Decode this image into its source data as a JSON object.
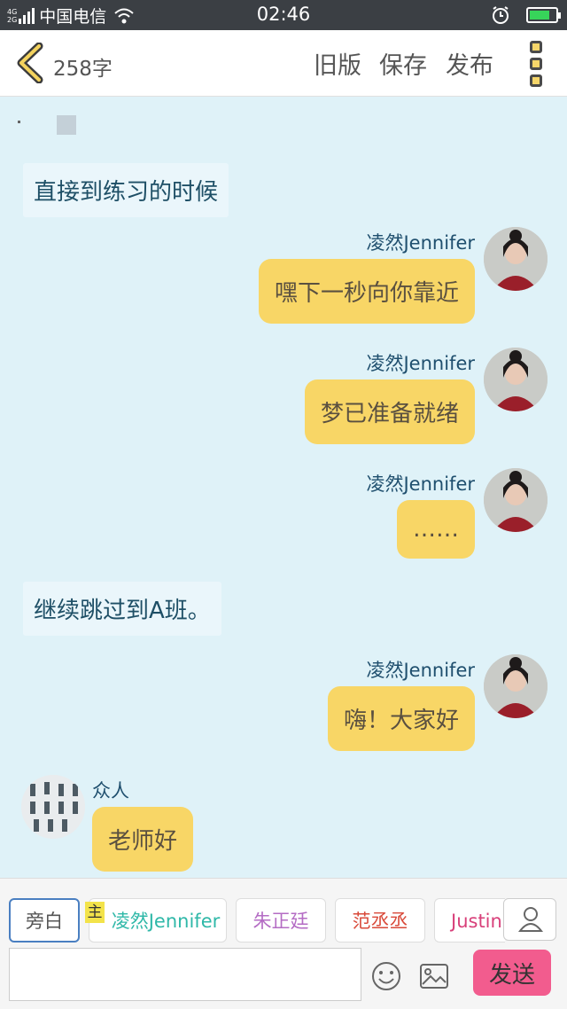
{
  "status_bar": {
    "network": [
      "4G",
      "2G"
    ],
    "carrier": "中国电信",
    "time": "02:46"
  },
  "toolbar": {
    "word_count": "258字",
    "old_version": "旧版",
    "save": "保存",
    "publish": "发布"
  },
  "chat": {
    "narration_1": "直接到练习的时候",
    "narration_2": "继续跳过到A班。",
    "messages": [
      {
        "name": "凌然Jennifer",
        "text": "嘿下一秒向你靠近"
      },
      {
        "name": "凌然Jennifer",
        "text": "梦已准备就绪"
      },
      {
        "name": "凌然Jennifer",
        "text": "……"
      },
      {
        "name": "凌然Jennifer",
        "text": "嗨！大家好"
      },
      {
        "name": "众人",
        "text": "老师好"
      }
    ]
  },
  "bottom_bar": {
    "main_tag": "主",
    "roles": [
      {
        "label": "旁白",
        "color": "#555555"
      },
      {
        "label": "凌然Jennifer",
        "color": "#2fb8a8"
      },
      {
        "label": "朱正廷",
        "color": "#b46cc4"
      },
      {
        "label": "范丞丞",
        "color": "#d94a3a"
      },
      {
        "label": "Justin黄",
        "color": "#d8407a"
      }
    ],
    "input_placeholder": "",
    "send_label": "发送"
  }
}
